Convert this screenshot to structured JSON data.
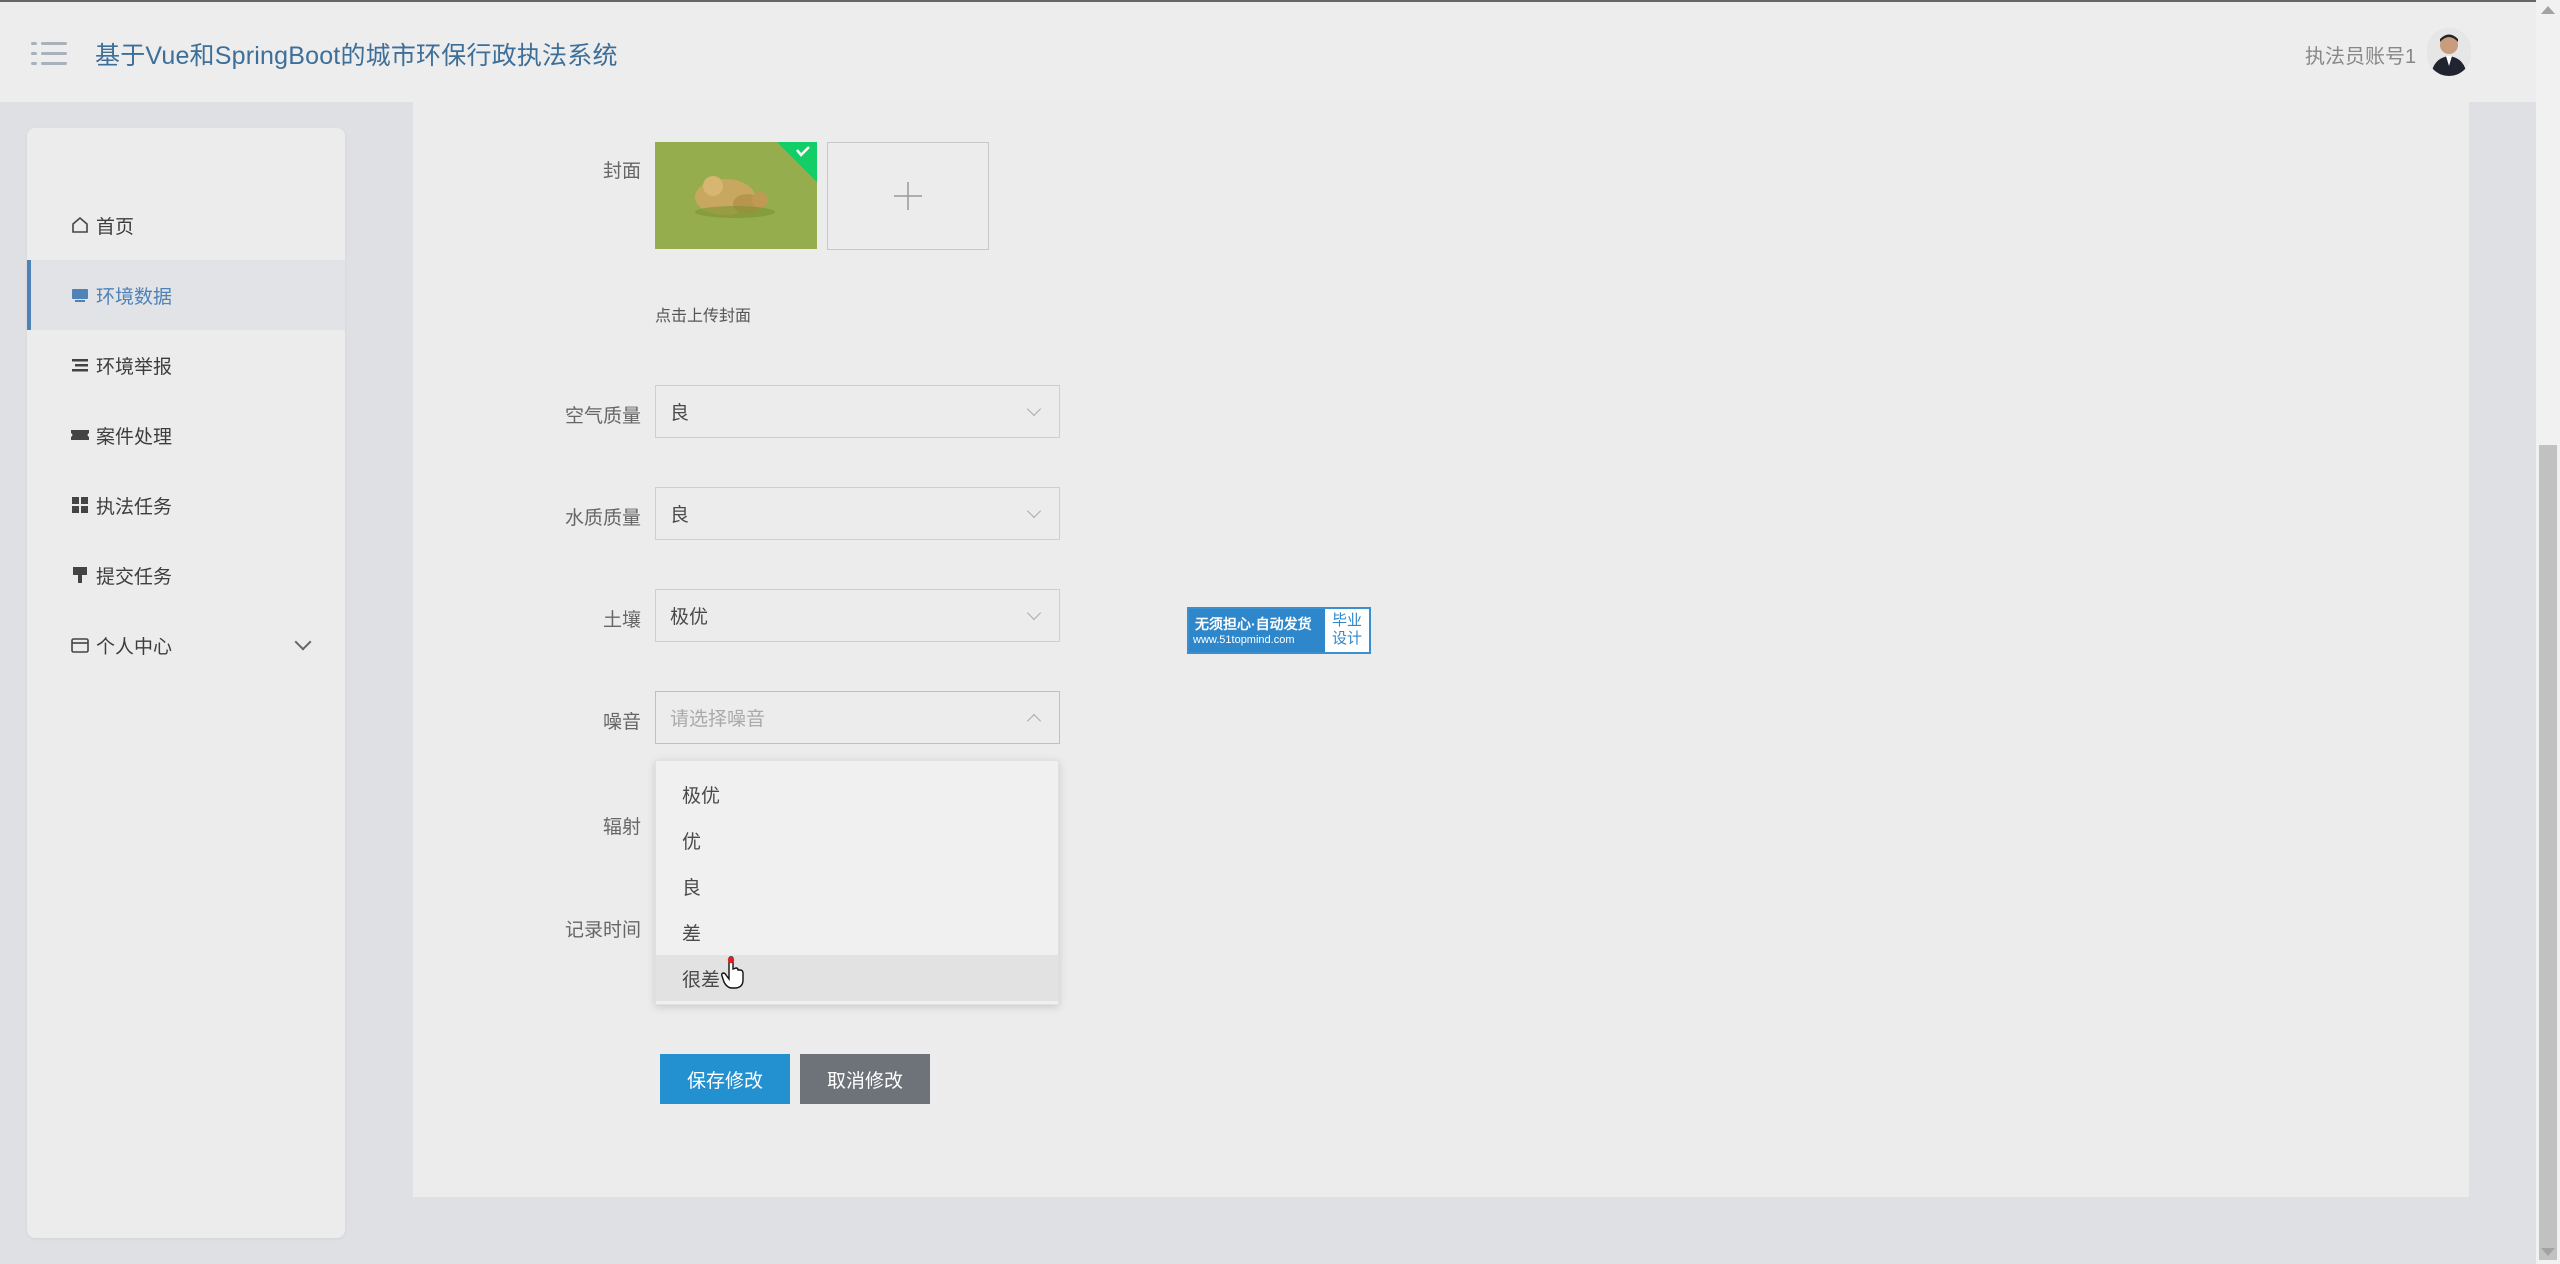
{
  "header": {
    "title": "基于Vue和SpringBoot的城市环保行政执法系统",
    "user_name": "执法员账号1"
  },
  "sidebar": {
    "items": [
      {
        "label": "首页",
        "icon": "home-icon"
      },
      {
        "label": "环境数据",
        "icon": "monitor-icon"
      },
      {
        "label": "环境举报",
        "icon": "list-icon"
      },
      {
        "label": "案件处理",
        "icon": "ticket-icon"
      },
      {
        "label": "执法任务",
        "icon": "grid-icon"
      },
      {
        "label": "提交任务",
        "icon": "brush-icon"
      },
      {
        "label": "个人中心",
        "icon": "wallet-icon"
      }
    ]
  },
  "form": {
    "cover_label": "封面",
    "cover_hint": "点击上传封面",
    "air_label": "空气质量",
    "air_value": "良",
    "water_label": "水质质量",
    "water_value": "良",
    "soil_label": "土壤",
    "soil_value": "极优",
    "noise_label": "噪音",
    "noise_placeholder": "请选择噪音",
    "radiation_label": "辐射",
    "record_time_label": "记录时间",
    "noise_options": [
      "极优",
      "优",
      "良",
      "差",
      "很差"
    ],
    "hovered_option": "很差",
    "save_label": "保存修改",
    "cancel_label": "取消修改"
  },
  "watermark": {
    "line1": "无须担心·自动发货",
    "line2": "www.51topmind.com",
    "right": "毕业设计"
  },
  "colors": {
    "accent": "#4f82b6",
    "save_button": "#2390cf",
    "cancel_button": "#6e7379"
  }
}
